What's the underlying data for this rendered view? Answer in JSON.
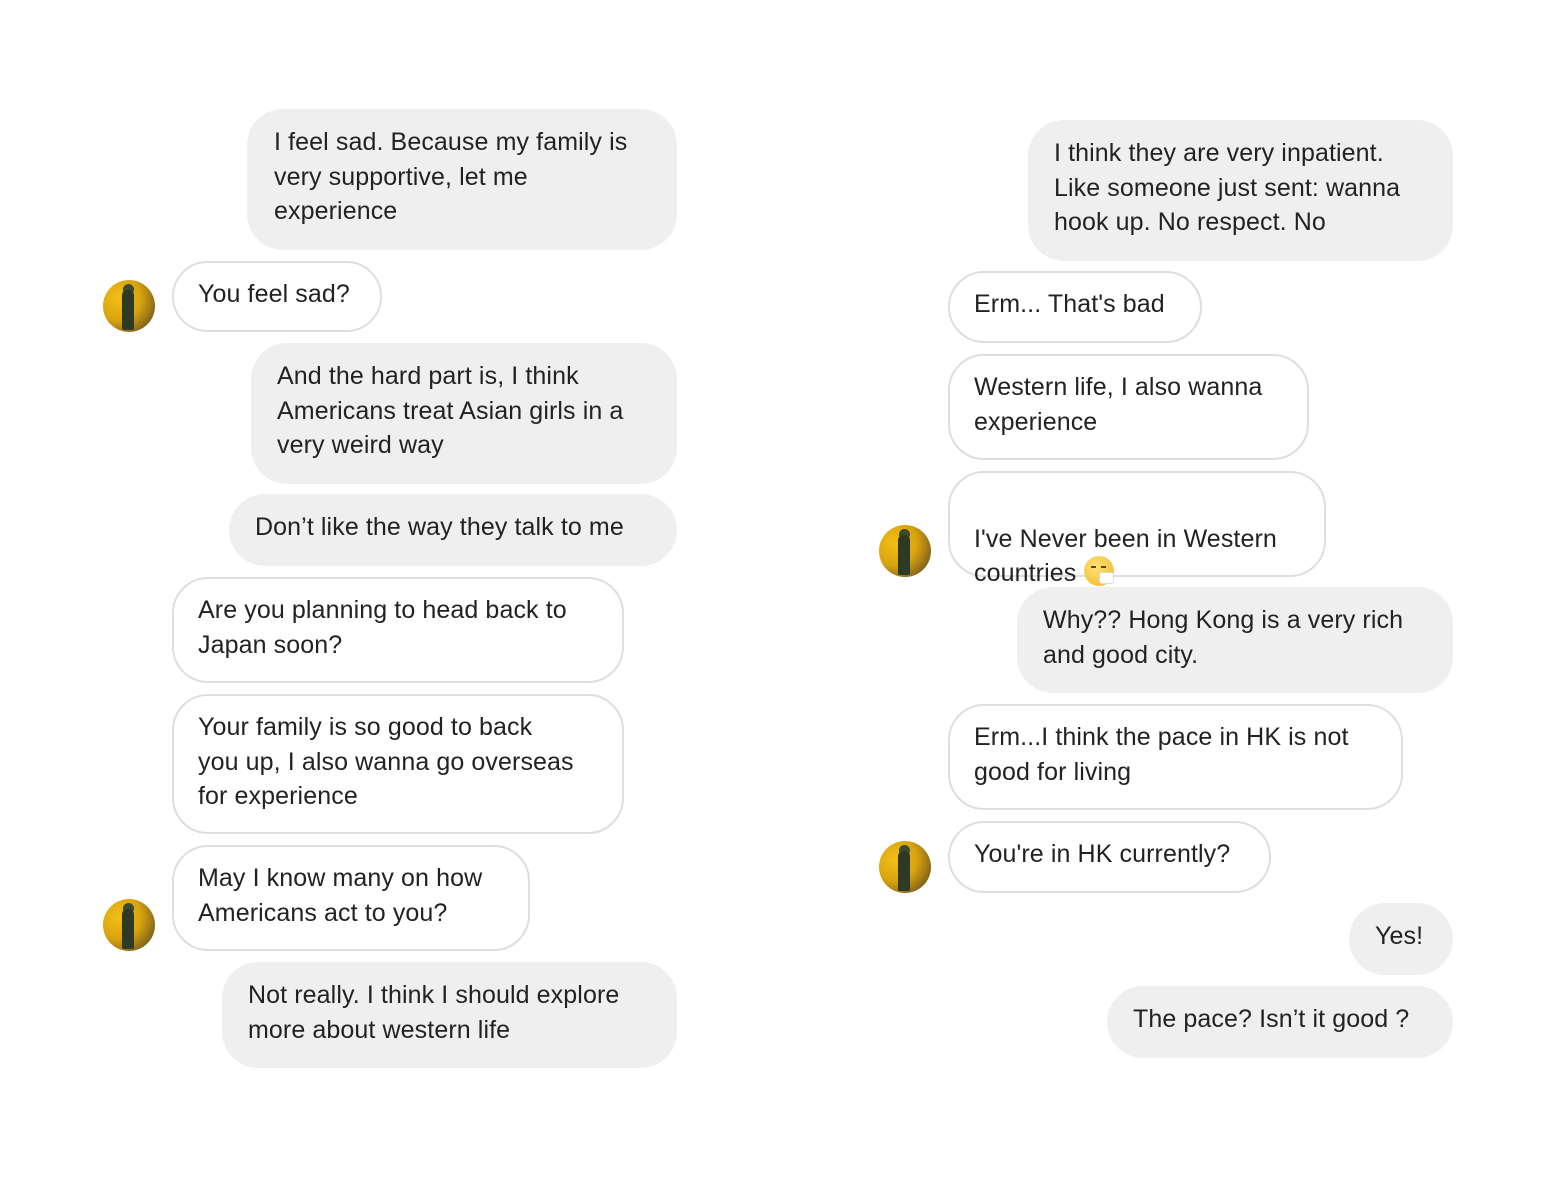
{
  "left_column": {
    "messages": [
      {
        "side": "sent",
        "text": "I feel sad. Because my family is\nvery supportive, let me\nexperience"
      },
      {
        "side": "received",
        "text": "You feel sad?"
      },
      {
        "side": "sent",
        "text": "And the hard part is, I think\nAmericans treat Asian girls in a\nvery weird way"
      },
      {
        "side": "sent",
        "text": "Don’t like the way they talk to me"
      },
      {
        "side": "received",
        "text": "Are you planning to head back to\nJapan soon?"
      },
      {
        "side": "received",
        "text": "Your family is so good to back\nyou up, I also wanna go overseas\nfor experience"
      },
      {
        "side": "received",
        "text": "May I know many on how\nAmericans act to you?"
      },
      {
        "side": "sent",
        "text": "Not really. I think I should explore\nmore about western life"
      }
    ]
  },
  "right_column": {
    "messages": [
      {
        "side": "sent",
        "text": "I think they are very inpatient.\nLike someone just sent: wanna\nhook up. No respect. No"
      },
      {
        "side": "received",
        "text": "Erm... That's bad"
      },
      {
        "side": "received",
        "text": "Western life, I also wanna\nexperience"
      },
      {
        "side": "received",
        "text": "I've Never been in Western\ncountries",
        "emoji": "sneezing-face-icon"
      },
      {
        "side": "sent",
        "text": "Why?? Hong Kong is a very rich\nand good city."
      },
      {
        "side": "received",
        "text": "Erm...I think the pace in HK is not\ngood for living"
      },
      {
        "side": "received",
        "text": "You're in HK currently?"
      },
      {
        "side": "sent",
        "text": "Yes!"
      },
      {
        "side": "sent",
        "text": "The pace? Isn’t it good ?"
      }
    ]
  },
  "avatar": {
    "icon": "contact-avatar-icon"
  },
  "colors": {
    "sent_bubble": "#efefef",
    "received_border": "#dedede",
    "text": "#222222",
    "background": "#ffffff"
  }
}
